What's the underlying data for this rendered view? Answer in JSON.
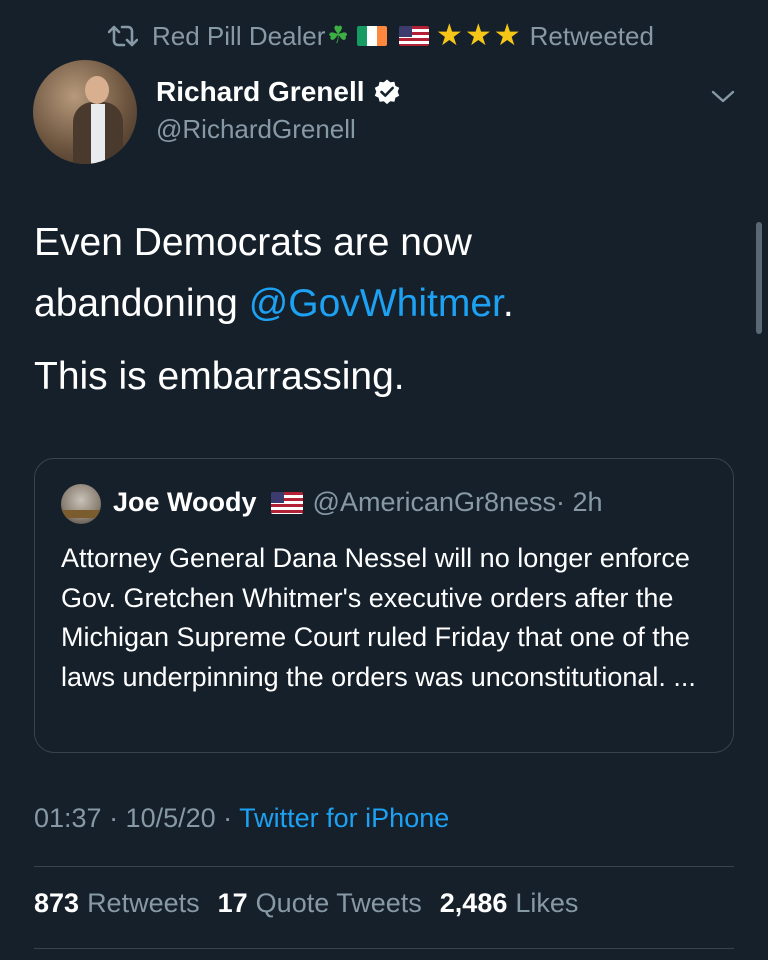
{
  "retweet_bar": {
    "retweeter_name": "Red Pill Dealer",
    "emoji_clover": "☘",
    "emoji_stars": [
      "★",
      "★",
      "★"
    ],
    "label": "Retweeted"
  },
  "tweet": {
    "author": {
      "name": "Richard Grenell",
      "handle": "@RichardGrenell",
      "verified": true
    },
    "text_line1_prefix": "Even Democrats are now",
    "text_line2_prefix": "abandoning ",
    "mention": "@GovWhitmer",
    "text_line2_suffix": ".",
    "text_para2": "This is embarrassing.",
    "timestamp": "01:37 · 10/5/20 · ",
    "source": "Twitter for iPhone"
  },
  "quote": {
    "name": "Joe Woody",
    "handle": "@AmericanGr8ness",
    "time": " · 2h",
    "text": "Attorney General Dana Nessel will no longer enforce Gov. Gretchen Whitmer's executive orders after the Michigan Supreme Court ruled Friday that one of the laws underpinning the orders was unconstitutional. ..."
  },
  "stats": [
    {
      "count": "873",
      "label": "Retweets"
    },
    {
      "count": "17",
      "label": "Quote Tweets"
    },
    {
      "count": "2,486",
      "label": "Likes"
    }
  ],
  "colors": {
    "background": "#15202b",
    "secondary_text": "#8899a6",
    "accent_blue": "#1da1f2",
    "border": "#38444d"
  }
}
